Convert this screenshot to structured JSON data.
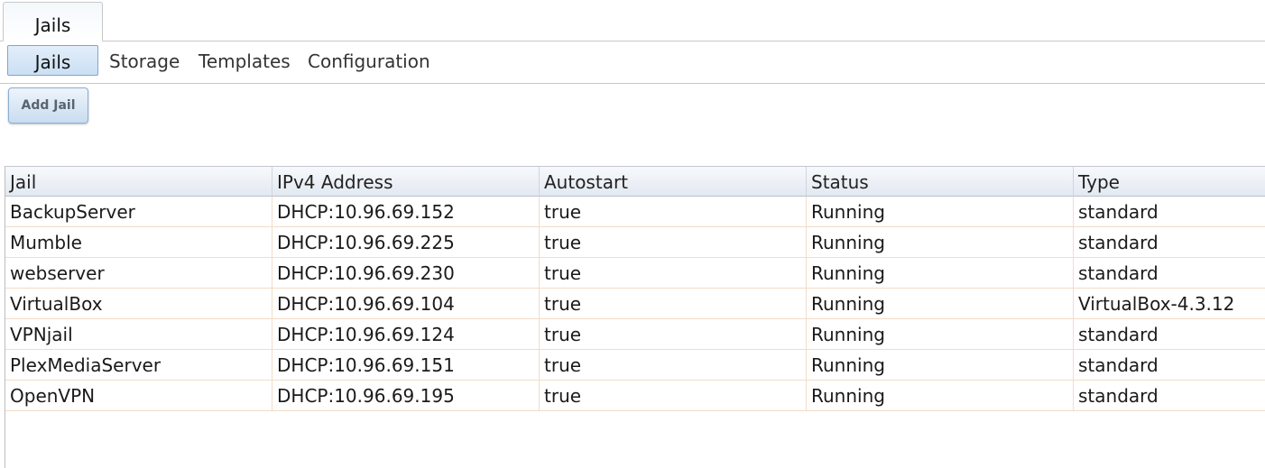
{
  "top_tabs": [
    {
      "label": "Jails"
    }
  ],
  "subnav": {
    "items": [
      {
        "label": "Jails",
        "active": true
      },
      {
        "label": "Storage",
        "active": false
      },
      {
        "label": "Templates",
        "active": false
      },
      {
        "label": "Configuration",
        "active": false
      }
    ]
  },
  "toolbar": {
    "add_label": "Add Jail"
  },
  "grid": {
    "columns": [
      "Jail",
      "IPv4 Address",
      "Autostart",
      "Status",
      "Type"
    ],
    "rows": [
      [
        "BackupServer",
        "DHCP:10.96.69.152",
        "true",
        "Running",
        "standard"
      ],
      [
        "Mumble",
        "DHCP:10.96.69.225",
        "true",
        "Running",
        "standard"
      ],
      [
        "webserver",
        "DHCP:10.96.69.230",
        "true",
        "Running",
        "standard"
      ],
      [
        "VirtualBox",
        "DHCP:10.96.69.104",
        "true",
        "Running",
        "VirtualBox-4.3.12"
      ],
      [
        "VPNjail",
        "DHCP:10.96.69.124",
        "true",
        "Running",
        "standard"
      ],
      [
        "PlexMediaServer",
        "DHCP:10.96.69.151",
        "true",
        "Running",
        "standard"
      ],
      [
        "OpenVPN",
        "DHCP:10.96.69.195",
        "true",
        "Running",
        "standard"
      ]
    ]
  },
  "colors": {
    "accent_border": "#7ea6cf",
    "row_border": "#f2dcc8",
    "header_bg": "#e3e9f1"
  }
}
